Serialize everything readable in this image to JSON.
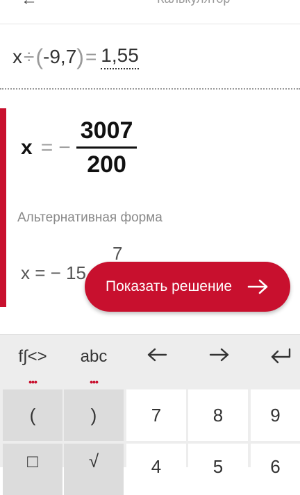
{
  "header": {
    "title": "Калькулятор"
  },
  "input": {
    "var": "x",
    "op": "÷",
    "lparen": "(",
    "value": "-9,7",
    "rparen": ")",
    "eq": "=",
    "rhs": "1,55"
  },
  "result": {
    "var": "x",
    "eq": "=",
    "sign": "−",
    "numerator": "3007",
    "denominator": "200"
  },
  "alternative": {
    "label": "Альтернативная форма",
    "expr": "x = − 15",
    "sup": "7"
  },
  "show_solution": {
    "label": "Показать решение"
  },
  "keyboard": {
    "tabs": [
      {
        "label": "f∫<>",
        "dots": "•••"
      },
      {
        "label": "abc",
        "dots": "•••"
      }
    ],
    "row1": [
      "(",
      ")",
      "7",
      "8",
      "9"
    ],
    "row2": [
      "□",
      "√",
      "4",
      "5",
      "6"
    ]
  },
  "colors": {
    "accent": "#c8102e"
  }
}
